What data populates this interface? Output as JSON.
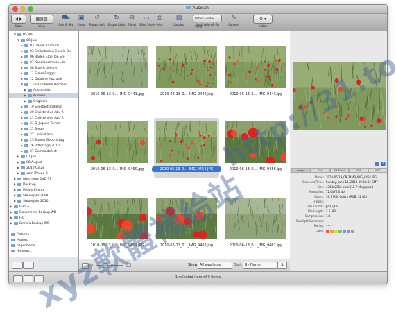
{
  "window": {
    "title": "Auswahl"
  },
  "toolbar": {
    "items": [
      {
        "label": "Back",
        "icon": "back-forward-icon"
      },
      {
        "label": "View",
        "icon": "view-mode-icon"
      },
      {
        "label": "Cart & Sky",
        "icon": "cart-icon"
      },
      {
        "label": "Open",
        "icon": "open-icon"
      },
      {
        "label": "Rotate Left",
        "icon": "rotate-left-icon"
      },
      {
        "label": "Rotate Right",
        "icon": "rotate-right-icon"
      },
      {
        "label": "E-Mail",
        "icon": "email-icon"
      },
      {
        "label": "Slide Show",
        "icon": "slideshow-icon"
      },
      {
        "label": "Print",
        "icon": "print-icon"
      },
      {
        "label": "Catalog",
        "icon": "catalog-icon"
      },
      {
        "label": "Destination & Go",
        "icon": "destination-icon"
      },
      {
        "label": "Convert",
        "icon": "convert-icon"
      },
      {
        "label": "Action",
        "icon": "gear-icon"
      }
    ],
    "destination_value": "Other Folder (.jpg"
  },
  "sidebar": {
    "tree": [
      {
        "label": "05 Mai",
        "indent": 1,
        "open": true
      },
      {
        "label": "06 Juni",
        "indent": 2,
        "open": true
      },
      {
        "label": "03 Daniel Kallauch",
        "indent": 3
      },
      {
        "label": "03 Strömkarlen Gesele Bu",
        "indent": 3
      },
      {
        "label": "06 Baden Elbe Ton Ste",
        "indent": 3
      },
      {
        "label": "07 Kanalanschluss Lüb",
        "indent": 3
      },
      {
        "label": "08 Storch bei uns",
        "indent": 3
      },
      {
        "label": "11 Steve Bogger",
        "indent": 3
      },
      {
        "label": "12 Goldene Hochzeit",
        "indent": 3
      },
      {
        "label": "12-13 Goldene Hochzeit",
        "indent": 3,
        "open": true
      },
      {
        "label": "Aussortiert",
        "indent": 4
      },
      {
        "label": "Auswahl",
        "indent": 4,
        "selected": true
      },
      {
        "label": "Originale",
        "indent": 4
      },
      {
        "label": "19 Sportgottesdienst",
        "indent": 3
      },
      {
        "label": "20 Christenlive Abu Ri",
        "indent": 3
      },
      {
        "label": "21 Christenlive Abu Ri",
        "indent": 3
      },
      {
        "label": "21 D-Jugend Turnier",
        "indent": 3
      },
      {
        "label": "21 Bieber",
        "indent": 3
      },
      {
        "label": "22 Lorenzkirch",
        "indent": 3
      },
      {
        "label": "23 Steves Geburtstag",
        "indent": 3
      },
      {
        "label": "26 Rittertage 2010",
        "indent": 3
      },
      {
        "label": "27 Gemeindefest",
        "indent": 3
      },
      {
        "label": "07 Juli",
        "indent": 2
      },
      {
        "label": "08 August",
        "indent": 2
      },
      {
        "label": "2010-03-28",
        "indent": 2
      },
      {
        "label": "vom iPhone 3",
        "indent": 2
      },
      {
        "label": "Abschieds DVD TS",
        "indent": 1
      },
      {
        "label": "Desktop",
        "indent": 1
      },
      {
        "label": "iMovie Events",
        "indent": 1
      },
      {
        "label": "Steuerjahr 2008",
        "indent": 1
      },
      {
        "label": "Steuerjahr 2010",
        "indent": 1
      },
      {
        "label": "Hisa 4",
        "indent": 0
      },
      {
        "label": "Dokumente Backup WD",
        "indent": 0
      },
      {
        "label": "Fisi",
        "indent": 0
      },
      {
        "label": "Extrafu Backup WD",
        "indent": 0
      }
    ],
    "places": [
      "Pictures",
      "Movies",
      "hagenheide",
      "Hintergr..."
    ]
  },
  "grid": {
    "items": [
      {
        "caption": "2010-06-13_0..._IMG_9441.jpg",
        "scene": "grass",
        "selected": false
      },
      {
        "caption": "2010-06-13_0..._IMG_9442.jpg",
        "scene": "poppy-field",
        "selected": false
      },
      {
        "caption": "2010-06-13_0..._IMG_9443.jpg",
        "scene": "poppy-field",
        "selected": false
      },
      {
        "caption": "2010-06-13_0..._IMG_9450.jpg",
        "scene": "grass-poppy",
        "selected": false
      },
      {
        "caption": "2010-06-13_0..._IMG_9454.JPG",
        "scene": "poppy-field",
        "selected": true
      },
      {
        "caption": "2010-06-13_0..._IMG_9456.jpg",
        "scene": "poppies-big",
        "selected": false
      },
      {
        "caption": "2010-06-13_0..._IMG_9459.JPG",
        "scene": "poppies-big",
        "selected": false
      },
      {
        "caption": "2010-06-13_0..._IMG_9461.jpg",
        "scene": "poppies-big",
        "selected": false
      },
      {
        "caption": "2010-06-13_0..._IMG_9462.jpg",
        "scene": "grass",
        "selected": false
      }
    ],
    "show_label": "Show:",
    "show_value": "All available",
    "sort_label": "Sort:",
    "sort_value": "By Name"
  },
  "inspector": {
    "tabs": [
      "Image",
      "EXIF",
      "EXIFTool",
      "GPS",
      "IPTC"
    ],
    "active_tab": 0,
    "rows": [
      {
        "label": "Name:",
        "value": "2010-06-13_09.34.43_IMG_9454.JPG"
      },
      {
        "label": "Date and Time:",
        "value": "Sunday, June 13, 2010 09:34:43 GMT+"
      },
      {
        "label": "Size:",
        "value": "4368x2912 pixel (12.7 Megapixel)"
      },
      {
        "label": "Resolution:",
        "value": "72.0x72.0 dpi"
      },
      {
        "label": "Colors:",
        "value": "16.7 Mill. Colors (RGB, 32 Bit)"
      },
      {
        "label": "Frames:",
        "value": ""
      },
      {
        "label": "File Format:",
        "value": "JPEG/JFIF"
      },
      {
        "label": "File Length:",
        "value": "3.5 MB"
      },
      {
        "label": "Compression:",
        "value": "1:8"
      },
      {
        "label": "Spotlight Comment:",
        "value": ""
      },
      {
        "label": "Rating:",
        "value": "- - - - -"
      },
      {
        "label": "Label:",
        "value": ""
      }
    ],
    "label_colors": [
      "#e05a5a",
      "#e8a040",
      "#e8d84a",
      "#7cc46a",
      "#6a9de0",
      "#b07ed6",
      "#a0a0a0"
    ]
  },
  "statusbar": {
    "text": "1 selected item of 9 items"
  },
  "watermark": {
    "text1": "http://31.to",
    "text2": "xyz軟體補給站"
  },
  "colors": {
    "selection": "#3b75c9",
    "sidebar_selection": "#c8d4e4"
  }
}
